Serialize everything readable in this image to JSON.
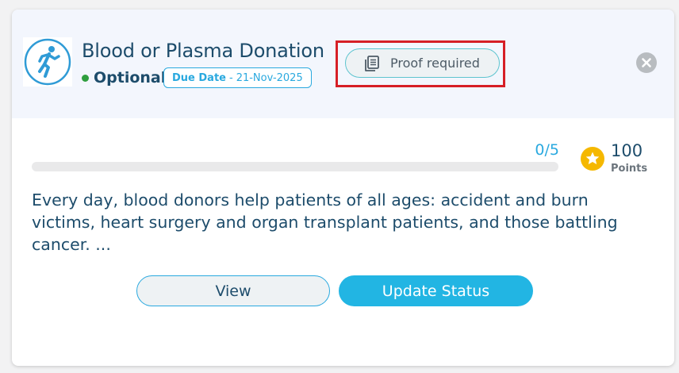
{
  "card": {
    "title": "Blood or Plasma Donation",
    "optional_label": "Optional",
    "due_date_label": "Due Date",
    "due_date_separator": "-",
    "due_date_value": "21-Nov-2025",
    "proof_label": "Proof required",
    "activity_icon": "running-person-icon",
    "proof_icon": "document-icon",
    "close_icon": "close-icon",
    "progress": {
      "text": "0/5",
      "current": 0,
      "total": 5
    },
    "points": {
      "value": "100",
      "label": "Points",
      "icon": "star-icon"
    },
    "description": "Every day, blood donors help patients of all ages: accident and burn victims, heart surgery and organ transplant patients, and those battling cancer. ...",
    "buttons": {
      "view": "View",
      "update_status": "Update Status"
    }
  },
  "colors": {
    "accent": "#2aa9df",
    "primary_button": "#22b5e3",
    "title_text": "#1d4c6b",
    "optional_dot": "#2e9e3e",
    "highlight_border": "#d61f26",
    "star": "#f5b800"
  }
}
